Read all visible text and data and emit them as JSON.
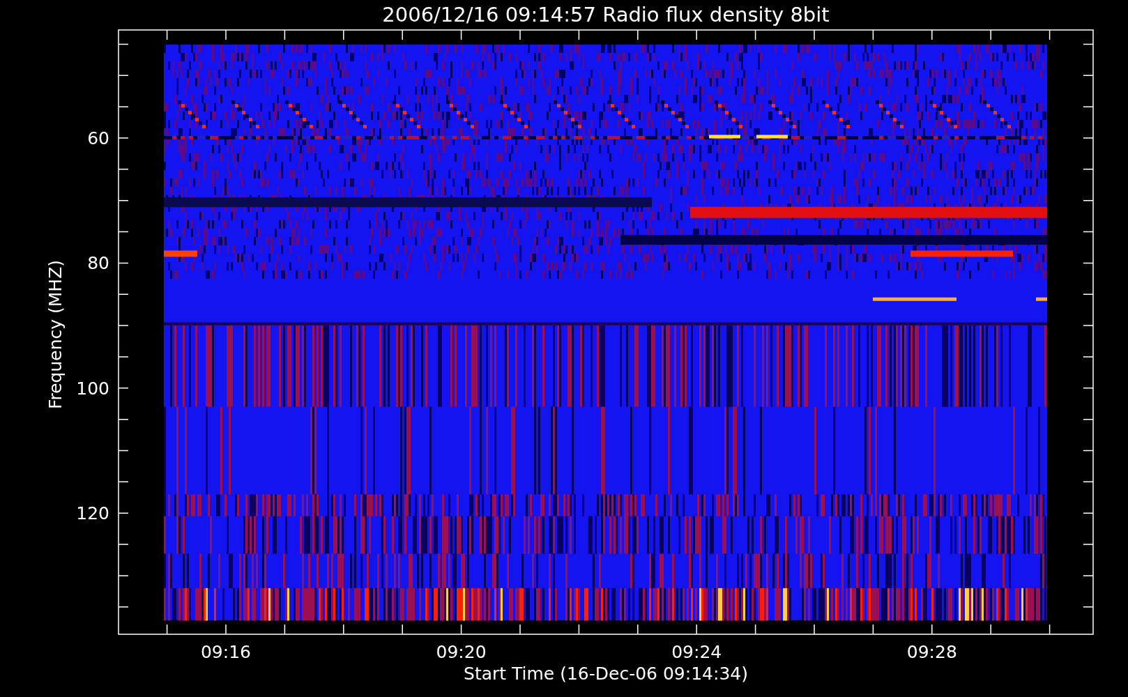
{
  "title": "2006/12/16 09:14:57 Radio flux density 8bit",
  "y_axis": {
    "label": "Frequency (MHZ)",
    "tick_labels": [
      "60",
      "80",
      "100",
      "120"
    ]
  },
  "x_axis": {
    "label": "Start Time (16-Dec-06 09:14:34)",
    "tick_labels": [
      "09:16",
      "09:20",
      "09:24",
      "09:28"
    ]
  }
}
